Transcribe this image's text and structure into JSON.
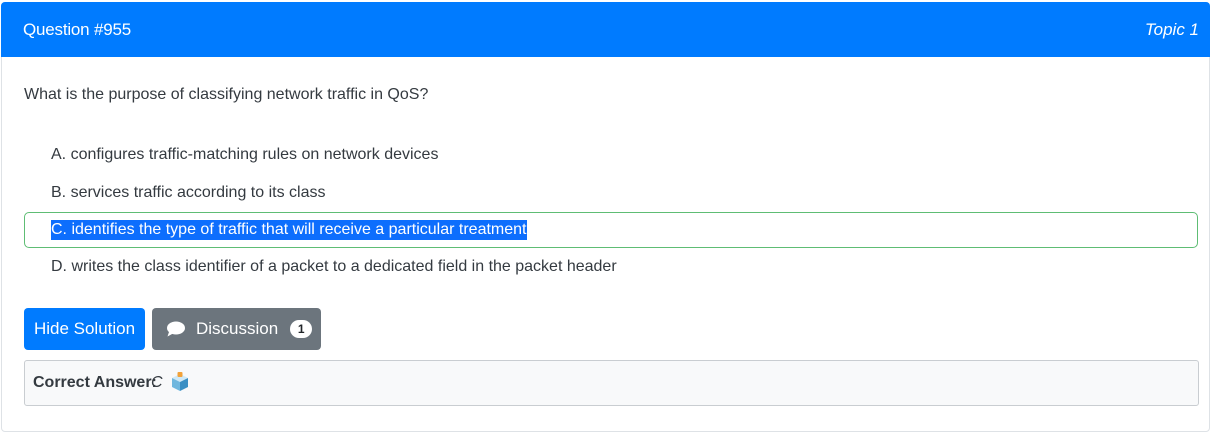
{
  "header": {
    "question_label": "Question #955",
    "topic_label": "Topic 1",
    "bg_color": "#007bff"
  },
  "question": {
    "text": "What is the purpose of classifying network traffic in QoS?"
  },
  "choices": [
    {
      "text": "A. configures traffic-matching rules on network devices"
    },
    {
      "text": "B. services traffic according to its class"
    },
    {
      "text": "C. identifies the type of traffic that will receive a particular treatment",
      "highlighted": true,
      "correct": true
    },
    {
      "text": "D. writes the class identifier of a packet to a dedicated field in the packet header"
    }
  ],
  "buttons": {
    "hide_solution": "Hide Solution",
    "discussion": "Discussion",
    "discussion_count": "1",
    "discussion_icon": "comment-icon"
  },
  "answer": {
    "label": "Correct Answer:",
    "value": "C",
    "icon": "vote-box-icon"
  },
  "colors": {
    "primary": "#007bff",
    "secondary": "#6c757d",
    "success_border": "#28a745",
    "selection": "#0d6efd"
  }
}
